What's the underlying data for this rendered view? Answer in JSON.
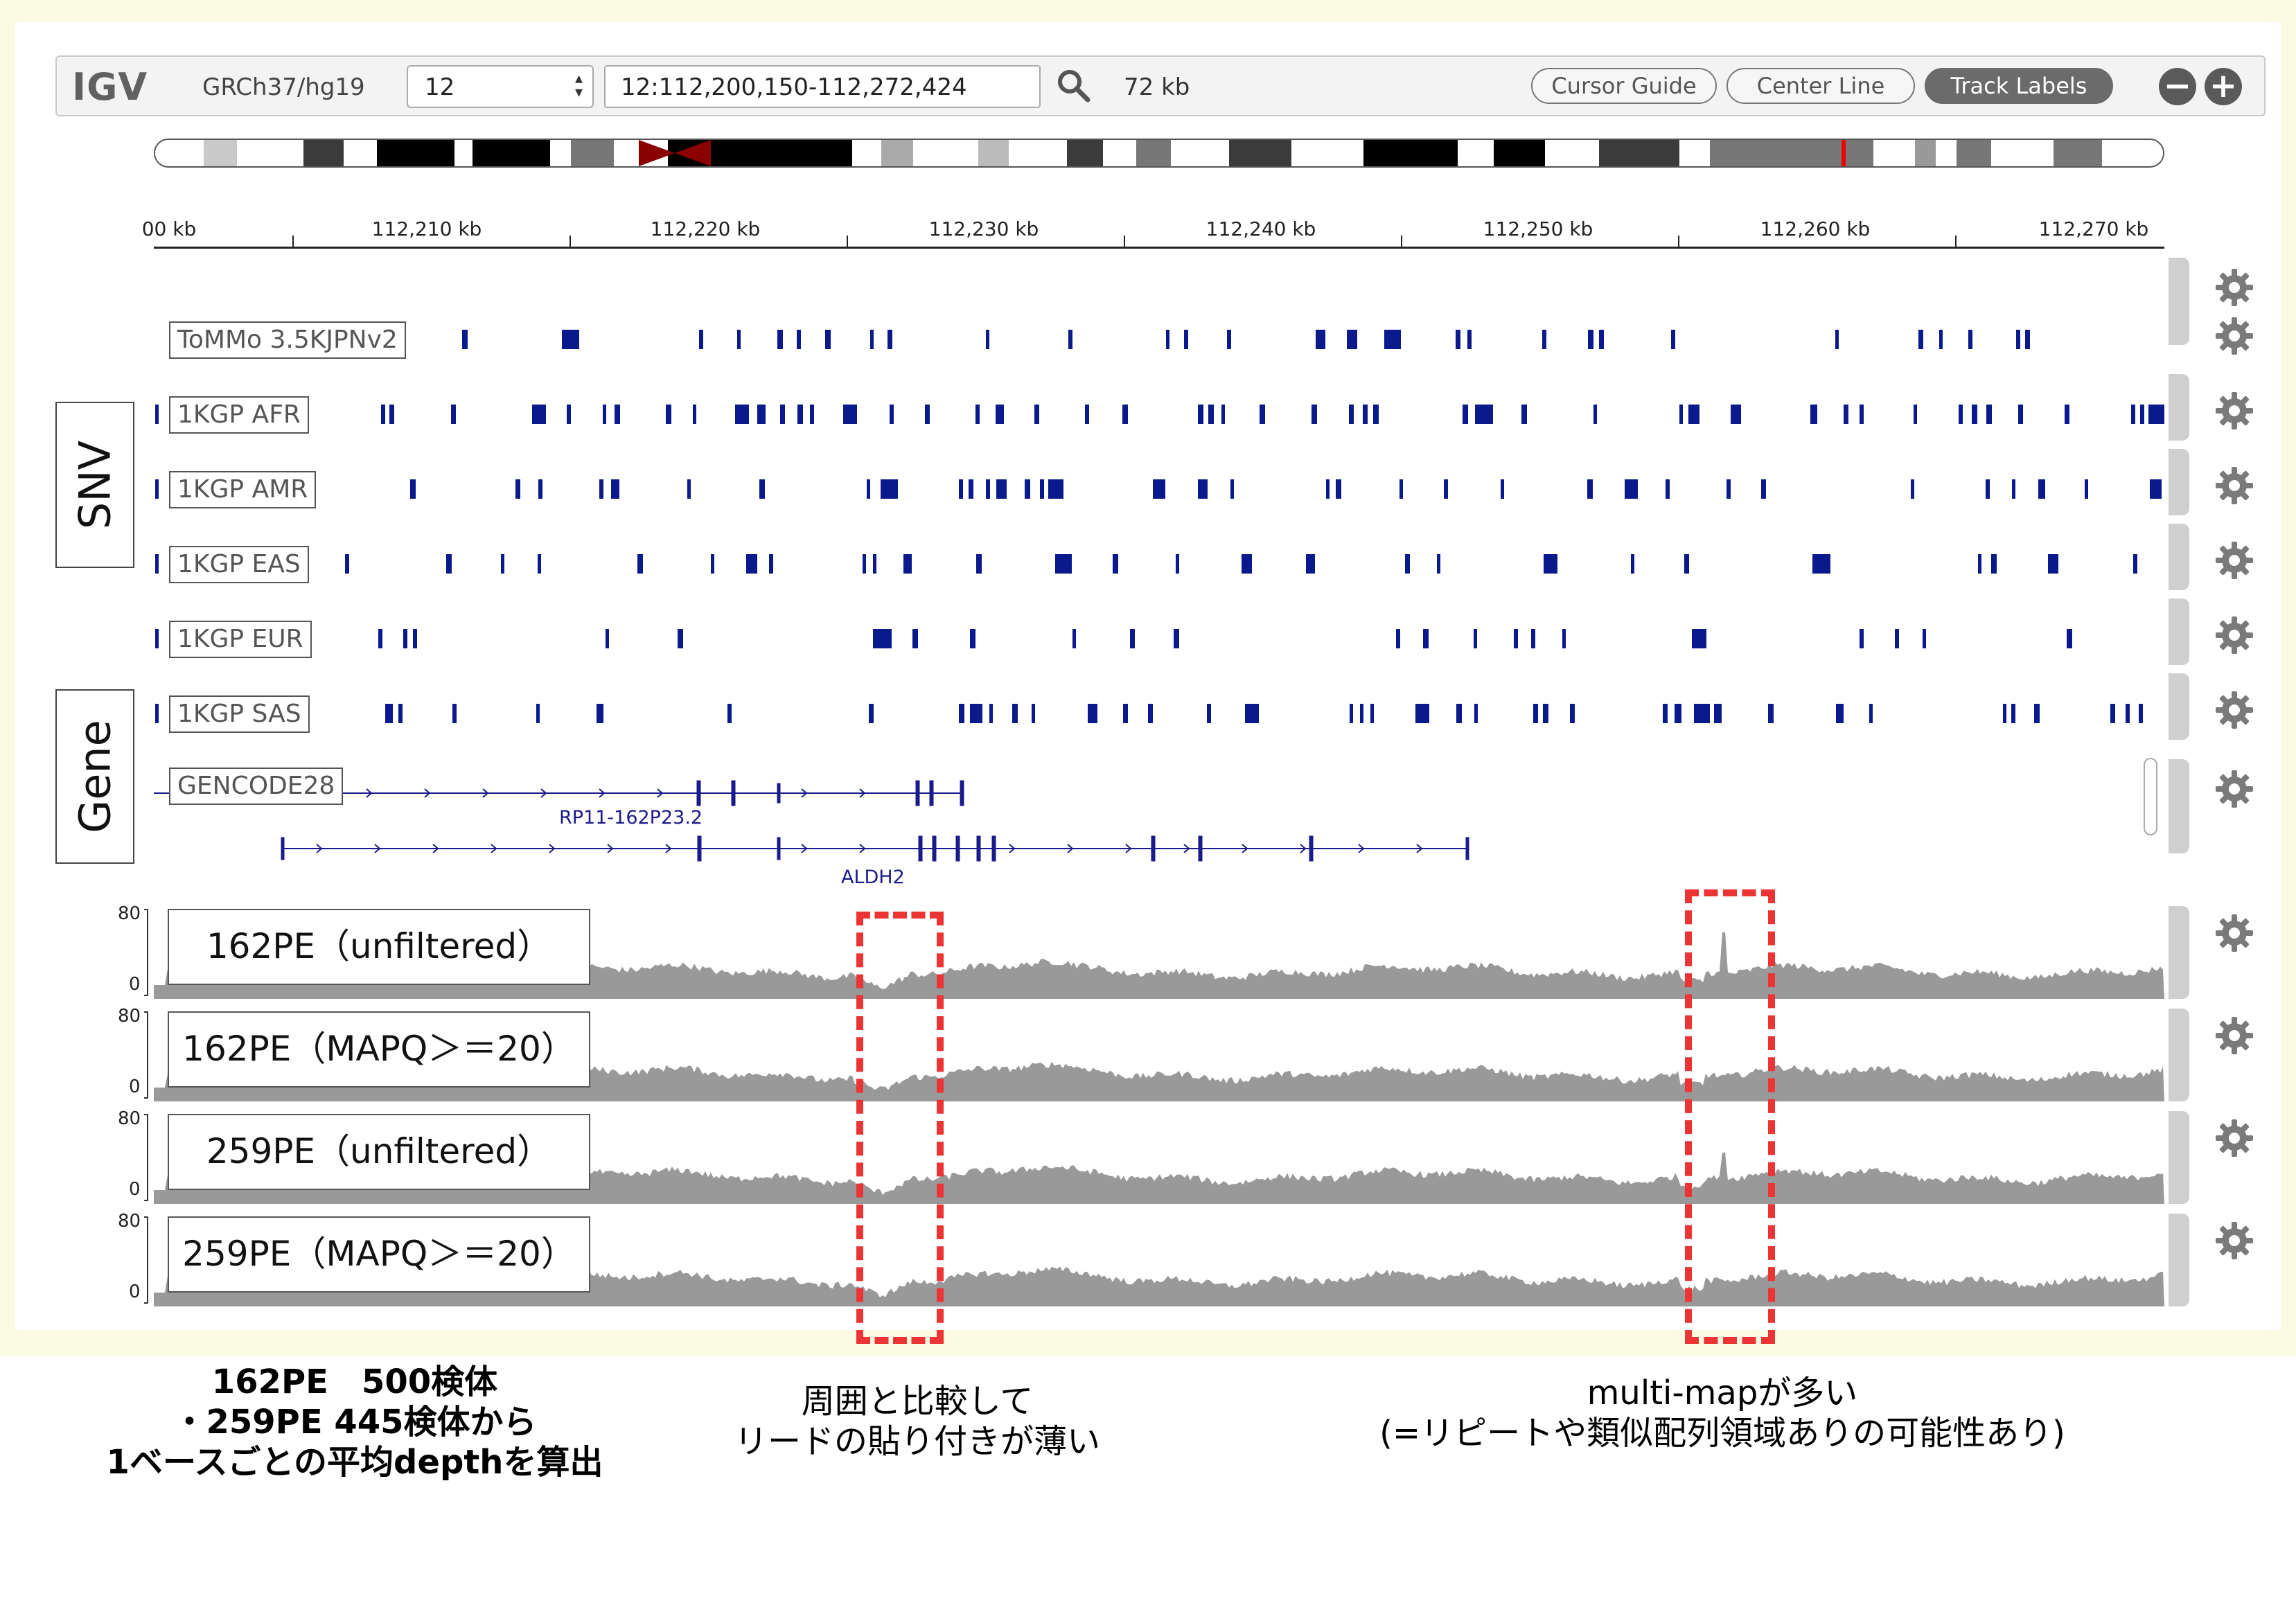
{
  "toolbar": {
    "logo": "IGV",
    "genome": "GRCh37/hg19",
    "chromosome": "12",
    "locus": "12:112,200,150-112,272,424",
    "width_label": "72 kb",
    "buttons": {
      "cursor_guide": "Cursor Guide",
      "center_line": "Center Line",
      "track_labels": "Track Labels"
    },
    "zoom_out": "−",
    "zoom_in": "+"
  },
  "ruler": {
    "labels": [
      "00 kb",
      "112,210 kb",
      "112,220 kb",
      "112,230 kb",
      "112,240 kb",
      "112,250 kb",
      "112,260 kb",
      "112,270 kb"
    ]
  },
  "groups": {
    "snv": "SNV",
    "gene": "Gene"
  },
  "snv_tracks": [
    "ToMMo 3.5KJPNv2",
    "1KGP AFR",
    "1KGP AMR",
    "1KGP EAS",
    "1KGP EUR",
    "1KGP SAS"
  ],
  "gene_track": {
    "label": "GENCODE28",
    "genes": [
      "RP11-162P23.2",
      "ALDH2"
    ]
  },
  "coverage_tracks": [
    {
      "label": "162PE（unfiltered）",
      "max": "80",
      "min": "0"
    },
    {
      "label": "162PE（MAPQ＞＝20）",
      "max": "80",
      "min": "0"
    },
    {
      "label": "259PE（unfiltered）",
      "max": "80",
      "min": "0"
    },
    {
      "label": "259PE（MAPQ＞＝20）",
      "max": "80",
      "min": "0"
    }
  ],
  "colors": {
    "variant": "#0a1a8c",
    "coverage": "#999999",
    "highlight": "#ec3434",
    "background": "#fbfbe3"
  },
  "captions": {
    "left": [
      "162PE　500検体",
      "・259PE 445検体から",
      "1ベースごとの平均depthを算出"
    ],
    "middle": [
      "周囲と比較して",
      "リードの貼り付きが薄い"
    ],
    "right": [
      "multi-mapが多い",
      "(=リピートや類似配列領域ありの可能性あり)"
    ]
  }
}
